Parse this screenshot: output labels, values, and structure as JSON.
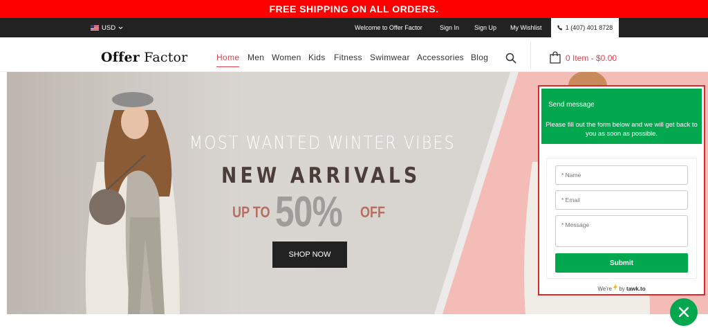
{
  "promo": {
    "text": "FREE SHIPPING ON ALL ORDERS."
  },
  "topbar": {
    "currency": "USD",
    "links": [
      "Welcome to Offer Factor",
      "Sign In",
      "Sign Up",
      "My Wishlist"
    ],
    "phone": "1 (407) 401 8728"
  },
  "header": {
    "logo": {
      "part1": "Offer",
      "part2": " Factor"
    },
    "nav": [
      "Home",
      "Men",
      "Women",
      "Kids",
      "Fitness",
      "Swimwear",
      "Accessories",
      "Blog"
    ],
    "active_nav": "Home",
    "cart_text": "0 Item - $0.00"
  },
  "hero": {
    "line1": "MOST WANTED WINTER VIBES",
    "line2": "NEW ARRIVALS",
    "upto": "UP TO",
    "percent": "50%",
    "off": "OFF",
    "button": "SHOP NOW"
  },
  "chat_widget": {
    "title": "Send message",
    "description": "Please fill out the form below and we will get back to you as soon as possible.",
    "fields": {
      "name_placeholder": "* Name",
      "email_placeholder": "* Email",
      "message_placeholder": "* Message"
    },
    "submit": "Submit",
    "powered_prefix": "We're",
    "powered_by": "by",
    "powered_brand": "tawk.to"
  },
  "colors": {
    "promo_bg": "#ff0000",
    "topbar_bg": "#222222",
    "nav_active": "#e0434e",
    "widget_green": "#03a84e",
    "widget_border": "#e0252b"
  }
}
